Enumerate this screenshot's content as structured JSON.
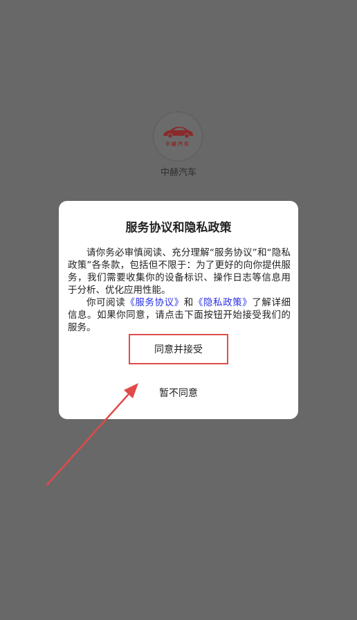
{
  "app": {
    "name": "中赫汽车",
    "logo_text": "中赫汽车"
  },
  "dialog": {
    "title": "服务协议和隐私政策",
    "para1": "请你务必审慎阅读、充分理解“服务协议”和“隐私政策”各条款，包括但不限于：为了更好的向你提供服务，我们需要收集你的设备标识、操作日志等信息用于分析、优化应用性能。",
    "para2_prefix": "你可阅读",
    "service_link": "《服务协议》",
    "and_text": "和",
    "privacy_link": "《隐私政策》",
    "para2_suffix": "了解详细信息。如果你同意，请点击下面按钮开始接受我们的服务。",
    "accept_label": "同意并接受",
    "decline_label": "暂不同意"
  },
  "colors": {
    "overlay": "#686868",
    "link": "#2b30e6",
    "annotation": "#e04a4a"
  }
}
